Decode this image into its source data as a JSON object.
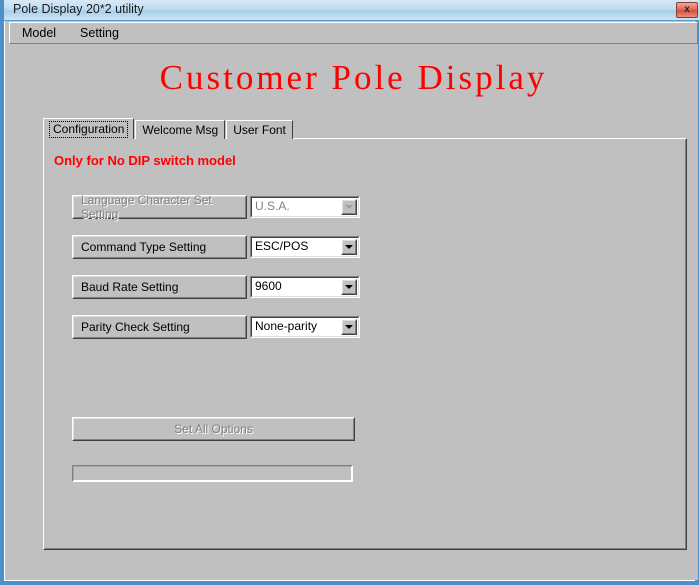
{
  "window": {
    "title": "Pole Display 20*2 utility",
    "close_label": "x",
    "accent_border": "#4d90c8",
    "face_color": "#c0c0c0"
  },
  "menubar": {
    "items": [
      {
        "label": "Model"
      },
      {
        "label": "Setting"
      }
    ]
  },
  "heading": {
    "text": "Customer Pole Display",
    "color": "#ff0000"
  },
  "tabs": [
    {
      "label": "Configuration",
      "active": true
    },
    {
      "label": "Welcome Msg",
      "active": false
    },
    {
      "label": "User Font",
      "active": false
    }
  ],
  "configuration": {
    "warning": "Only for No DIP switch model",
    "warning_color": "#ff0000",
    "rows": [
      {
        "button_label": "Language Character Set Setting",
        "combo_value": "U.S.A.",
        "enabled": false
      },
      {
        "button_label": "Command Type Setting",
        "combo_value": "ESC/POS",
        "enabled": true
      },
      {
        "button_label": "Baud Rate Setting",
        "combo_value": "9600",
        "enabled": true
      },
      {
        "button_label": "Parity Check Setting",
        "combo_value": "None-parity",
        "enabled": true
      }
    ],
    "set_all_label": "Set All Options",
    "set_all_enabled": false,
    "progress_percent": 0
  }
}
